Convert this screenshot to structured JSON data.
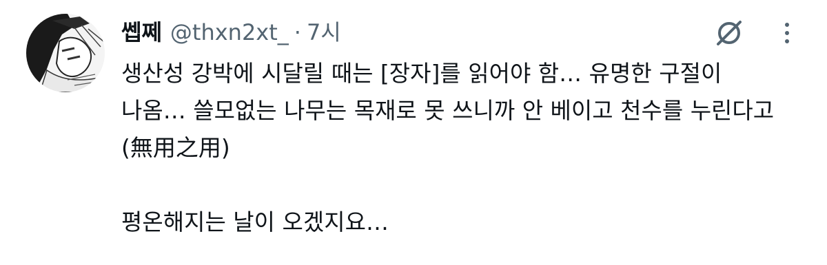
{
  "tweet": {
    "display_name": "쎕쩨",
    "handle": "@thxn2xt_",
    "separator": "·",
    "time": "7시",
    "lines": [
      "생산성 강박에 시달릴 때는 [장자]를 읽어야 함… 유명한 구절이",
      "나옴… 쓸모없는 나무는 목재로 못 쓰니까 안 베이고 천수를 누린다고",
      "(無用之用)",
      "",
      "평온해지는 날이 오겠지요…"
    ]
  },
  "icons": {
    "avatar": "avatar-illustration",
    "grok": "grok-icon",
    "more": "more-vertical-icon"
  },
  "colors": {
    "text": "#0f1419",
    "secondary": "#536471",
    "background": "#ffffff"
  }
}
